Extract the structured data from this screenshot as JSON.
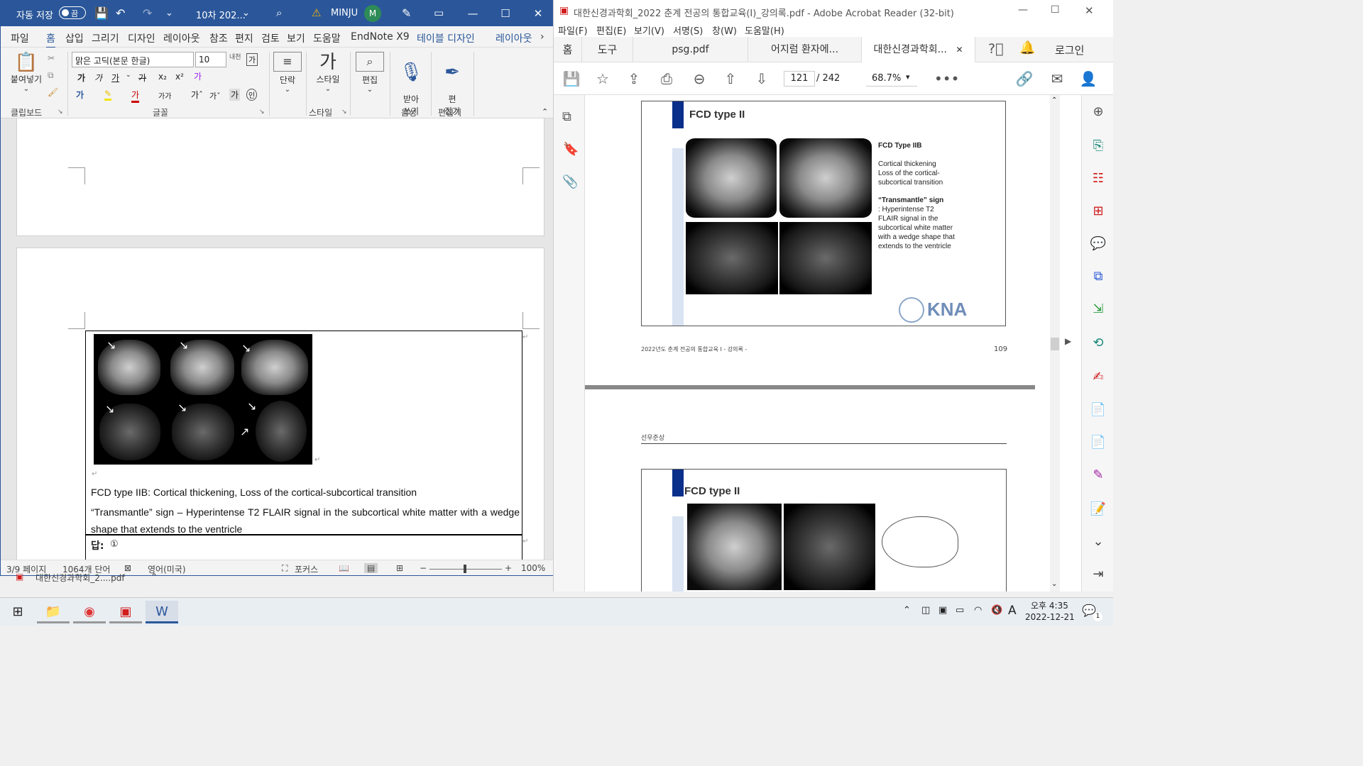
{
  "word": {
    "autosave_label": "자동 저장",
    "autosave_state": "끔",
    "doc_title": "10차 202...",
    "user_name": "MINJU",
    "user_initial": "M",
    "menu": [
      "파일",
      "홈",
      "삽입",
      "그리기",
      "디자인",
      "레이아웃",
      "참조",
      "편지",
      "검토",
      "보기",
      "도움말",
      "EndNote X9",
      "테이블 디자인",
      "레이아웃"
    ],
    "ribbon": {
      "paste": "붙여넣기",
      "clipboard_group": "클립보드",
      "font_name": "맑은 고딕(본문 한글)",
      "font_size": "10",
      "font_group": "글꼴",
      "paragraph": "단락",
      "styles": "스타일",
      "styles_group": "스타일",
      "editing": "편집",
      "dictate": "받아\n쓰기",
      "voice_group": "음성",
      "editor": "편\n집기",
      "editor_group": "편집기"
    },
    "doc": {
      "caption_line1": "FCD type IIB: Cortical thickening, Loss of the cortical-subcortical transition",
      "caption_line2": "“Transmantle” sign – Hyperintense T2 FLAIR signal in the subcortical white matter with a wedge shape that extends to the ventricle",
      "answer_label": "답:",
      "answer_value": "①"
    },
    "status": {
      "page": "3/9 페이지",
      "words": "1064개 단어",
      "language": "영어(미국)",
      "focus": "포커스",
      "zoom": "100%"
    },
    "below_tab": "대한신경과학회_2....pdf"
  },
  "acrobat": {
    "title": "대한신경과학회_2022 춘계 전공의 통합교육(I)_강의록.pdf - Adobe Acrobat Reader (32-bit)",
    "menu": [
      "파일(F)",
      "편집(E)",
      "보기(V)",
      "서명(S)",
      "창(W)",
      "도움말(H)"
    ],
    "tabs": [
      "홈",
      "도구",
      "psg.pdf",
      "어지럼 환자에...",
      "대한신경과학회..."
    ],
    "login": "로그인",
    "page_current": "121",
    "page_total": "/  242",
    "zoom": "68.7%",
    "slide1": {
      "title": "FCD type II",
      "heading": "FCD Type IIB",
      "text1": "Cortical thickening\nLoss of the cortical-\nsubcortical transition",
      "heading2": "“Transmantle” sign",
      "text2": ": Hyperintense T2\nFLAIR signal in the\nsubcortical white matter\nwith a wedge shape that\nextends to the ventricle",
      "logo": "KNA"
    },
    "footer_left": "2022년도 춘계 전공의 통합교육 I  - 강의록 -",
    "footer_page": "109",
    "section_label": "선우준상",
    "slide2": {
      "title": "FCD type II"
    }
  },
  "taskbar": {
    "time": "오후 4:35",
    "date": "2022-12-21",
    "notif_count": "1",
    "ime": "A"
  },
  "colors": {
    "word_blue": "#2b579a",
    "slide_accent": "#0a2f8a",
    "acrobat_red": "#d11d1d"
  }
}
